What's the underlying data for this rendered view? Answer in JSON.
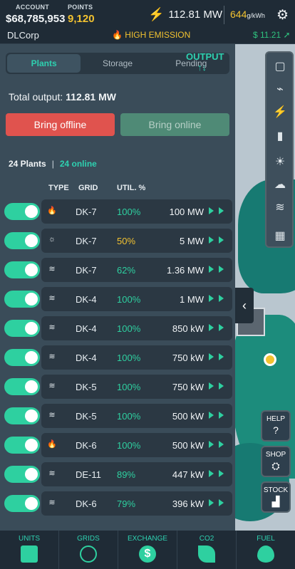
{
  "header": {
    "account_label": "ACCOUNT",
    "account_value": "$68,785,953",
    "points_label": "POINTS",
    "points_value": "9,120",
    "power": "112.81 MW",
    "price_value": "644",
    "price_unit": "g/kWh",
    "company": "DLCorp",
    "emission": "HIGH EMISSION",
    "money_rate": "$ 11.21"
  },
  "tabs": [
    "Plants",
    "Storage",
    "Pending"
  ],
  "total_label": "Total output:",
  "total_value": "112.81 MW",
  "buttons": {
    "offline": "Bring offline",
    "online": "Bring online"
  },
  "counts": {
    "plants": "24 Plants",
    "sep": "|",
    "online": "24 online"
  },
  "columns": {
    "type": "TYPE",
    "grid": "GRID",
    "util": "UTIL. %",
    "output": "OUTPUT ↑↓"
  },
  "rows": [
    {
      "icon": "fire-icon",
      "glyph": "🔥",
      "grid": "DK-7",
      "util": "100%",
      "output": "100 MW",
      "warn": false
    },
    {
      "icon": "sun-icon",
      "glyph": "☼",
      "grid": "DK-7",
      "util": "50%",
      "output": "5 MW",
      "warn": true
    },
    {
      "icon": "wind-icon",
      "glyph": "≋",
      "grid": "DK-7",
      "util": "62%",
      "output": "1.36 MW",
      "warn": false
    },
    {
      "icon": "wind-icon",
      "glyph": "≋",
      "grid": "DK-4",
      "util": "100%",
      "output": "1 MW",
      "warn": false
    },
    {
      "icon": "wind-icon",
      "glyph": "≋",
      "grid": "DK-4",
      "util": "100%",
      "output": "850 kW",
      "warn": false
    },
    {
      "icon": "wind-icon",
      "glyph": "≋",
      "grid": "DK-4",
      "util": "100%",
      "output": "750 kW",
      "warn": false
    },
    {
      "icon": "wind-icon",
      "glyph": "≋",
      "grid": "DK-5",
      "util": "100%",
      "output": "750 kW",
      "warn": false
    },
    {
      "icon": "wind-icon",
      "glyph": "≋",
      "grid": "DK-5",
      "util": "100%",
      "output": "500 kW",
      "warn": false
    },
    {
      "icon": "fire-icon",
      "glyph": "🔥",
      "grid": "DK-6",
      "util": "100%",
      "output": "500 kW",
      "warn": false
    },
    {
      "icon": "wind-icon",
      "glyph": "≋",
      "grid": "DE-11",
      "util": "89%",
      "output": "447 kW",
      "warn": false
    },
    {
      "icon": "wind-icon",
      "glyph": "≋",
      "grid": "DK-6",
      "util": "79%",
      "output": "396 kW",
      "warn": false
    }
  ],
  "side": {
    "help": "HELP",
    "shop": "SHOP",
    "stock": "STOCK"
  },
  "bottom_nav": [
    "UNITS",
    "GRIDS",
    "EXCHANGE",
    "CO2",
    "FUEL"
  ]
}
